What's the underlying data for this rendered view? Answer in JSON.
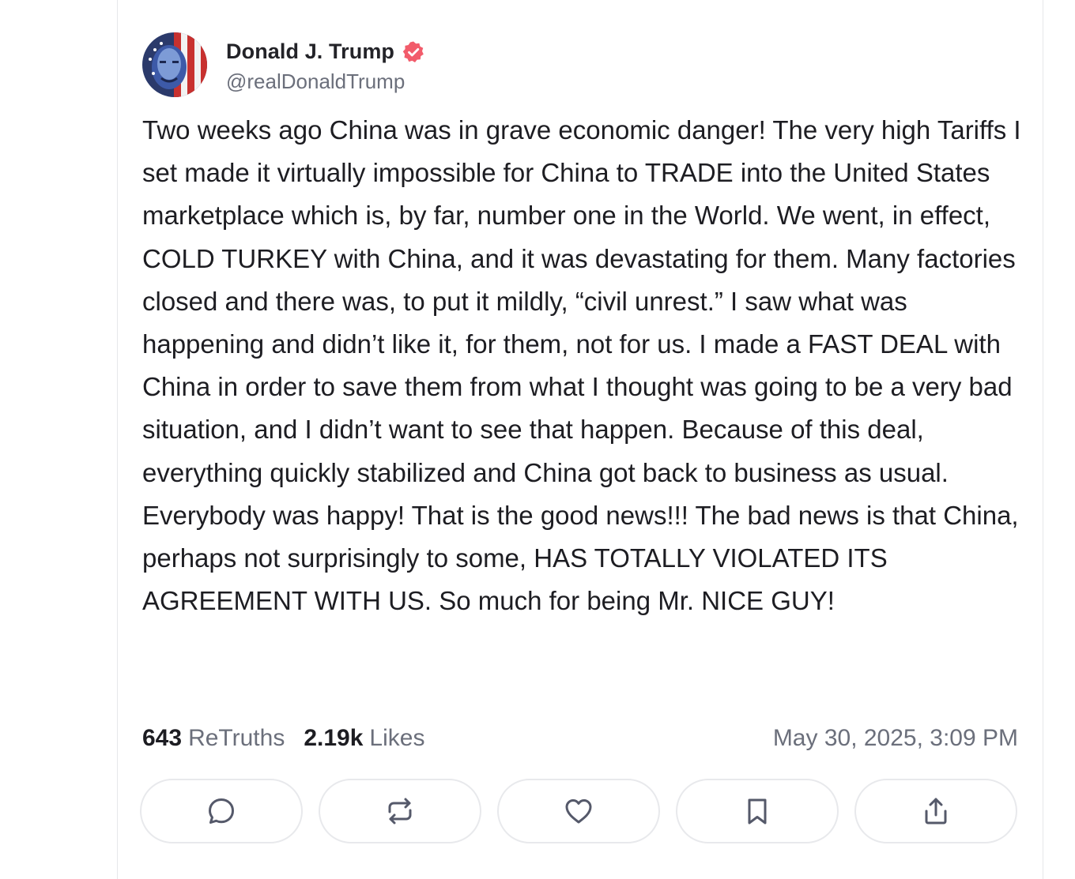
{
  "author": {
    "display_name": "Donald J. Trump",
    "handle": "@realDonaldTrump",
    "verified": true,
    "verified_color": "#f25c6b",
    "avatar_icon": "avatar-image"
  },
  "post": {
    "text": "Two weeks ago China was in grave economic danger! The very high Tariffs I set made it virtually impossible for China to TRADE into the United States marketplace which is, by far, number one in the World. We went, in effect, COLD TURKEY with China, and it was devastating for them. Many factories closed and there was, to put it mildly, “civil unrest.” I saw what was happening and didn’t like it, for them, not for us. I made a FAST DEAL with China in order to save them from what I thought was going to be a very bad situation, and I didn’t want to see that happen. Because of this deal, everything quickly stabilized and China got back to business as usual. Everybody was happy! That is the good news!!! The bad news is that China, perhaps not surprisingly to some, HAS TOTALLY VIOLATED ITS AGREEMENT WITH US. So much for being Mr. NICE GUY!"
  },
  "stats": {
    "retruths_count": "643",
    "retruths_label": "ReTruths",
    "likes_count": "2.19k",
    "likes_label": "Likes",
    "timestamp": "May 30, 2025, 3:09 PM"
  },
  "actions": [
    {
      "name": "reply",
      "icon": "comment-icon"
    },
    {
      "name": "retruth",
      "icon": "repost-icon"
    },
    {
      "name": "like",
      "icon": "heart-icon"
    },
    {
      "name": "bookmark",
      "icon": "bookmark-icon"
    },
    {
      "name": "share",
      "icon": "share-icon"
    }
  ],
  "colors": {
    "text": "#1d1d22",
    "muted": "#6b6f7b",
    "border": "#e8e9ec",
    "icon": "#55596a"
  }
}
